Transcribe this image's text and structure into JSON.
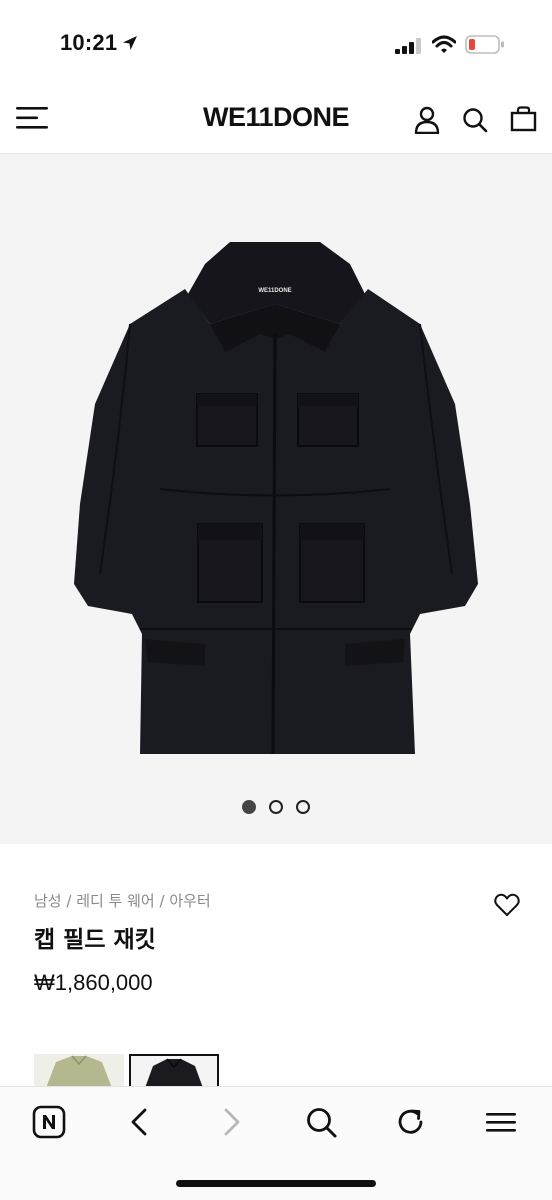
{
  "status_bar": {
    "time": "10:21",
    "icons": [
      "location-arrow-icon",
      "cellular-signal-icon",
      "wifi-icon",
      "battery-low-icon"
    ],
    "battery_color": "#e5483d"
  },
  "header": {
    "brand": "WE11DONE",
    "icons": [
      "hamburger-menu-icon",
      "user-icon",
      "search-icon",
      "shopping-bag-icon"
    ]
  },
  "gallery": {
    "background": "#f4f4f4",
    "image": "black-field-jacket",
    "image_label": "WE11DONE",
    "dots_total": 3,
    "dots_active": 1
  },
  "product": {
    "breadcrumb": "남성 / 레디 투 웨어 / 아우터",
    "name": "캡 필드 재킷",
    "price": "₩1,860,000",
    "wishlist_icon": "heart-outline-icon"
  },
  "swatches": [
    {
      "color": "khaki",
      "hex": "#b5b88f"
    },
    {
      "color": "black",
      "hex": "#1a1a1f",
      "selected": true
    }
  ],
  "browser_toolbar": {
    "icons": [
      "naver-n-icon",
      "back-arrow-icon",
      "forward-arrow-icon",
      "search-icon",
      "reload-icon",
      "menu-icon"
    ]
  }
}
